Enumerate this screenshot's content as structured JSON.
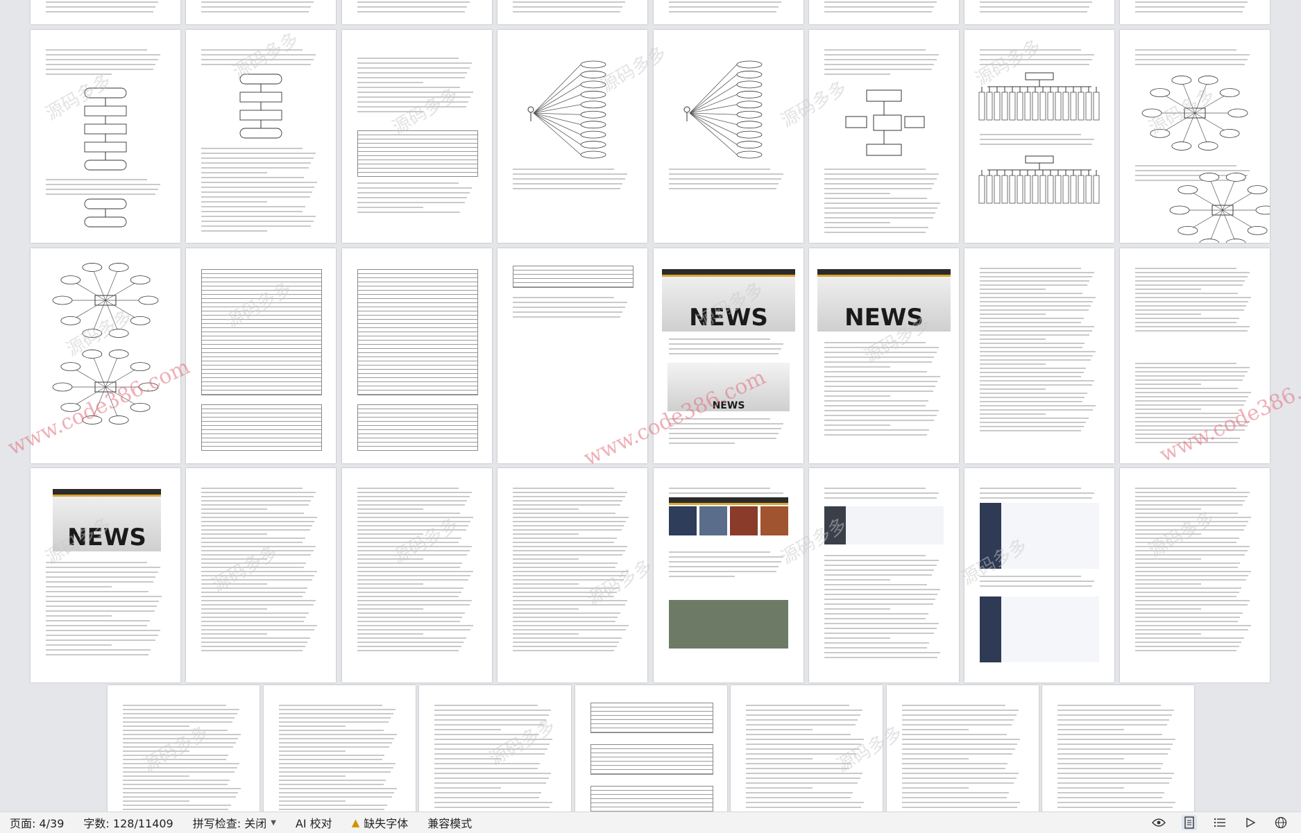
{
  "watermark_url": "www.code386.com",
  "watermark_cn": "源码多多",
  "news_label": "NEWS",
  "status": {
    "page": "页面: 4/39",
    "words": "字数: 128/11409",
    "spellcheck": "拼写检查: 关闭",
    "ai_proofread": "AI 校对",
    "missing_font": "缺失字体",
    "compat_mode": "兼容模式"
  },
  "icons": [
    "eye-icon",
    "page-view-icon",
    "outline-icon",
    "play-icon",
    "globe-icon"
  ]
}
